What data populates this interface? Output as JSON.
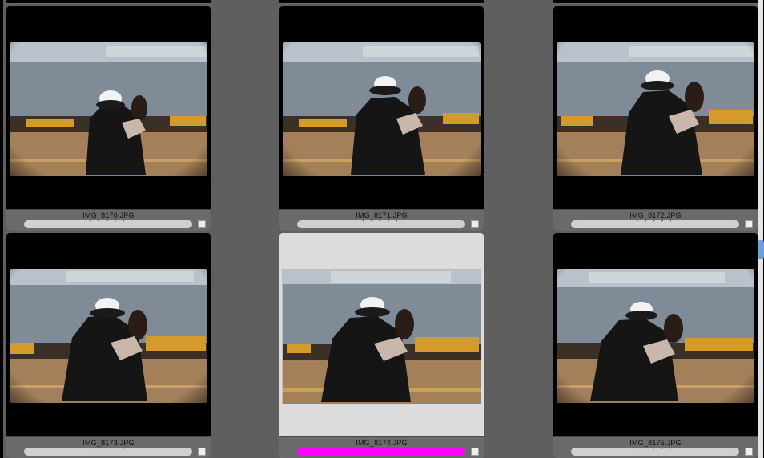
{
  "app": {
    "view": "grid"
  },
  "colors": {
    "background": "#5f5f5f",
    "cell": "#000000",
    "selected_cell": "#dcdcdc",
    "label_default": "#d0d0d0",
    "label_selected": "#ff00ff"
  },
  "thumbnails": [
    {
      "filename": "IMG_8170.JPG",
      "selected": false,
      "label": "none",
      "rating_dots": "• • • • •"
    },
    {
      "filename": "IMG_8171.JPG",
      "selected": false,
      "label": "none",
      "rating_dots": "• • • • •"
    },
    {
      "filename": "IMG_8172.JPG",
      "selected": false,
      "label": "none",
      "rating_dots": "• • • • •"
    },
    {
      "filename": "IMG_8173.JPG",
      "selected": false,
      "label": "none",
      "rating_dots": "• • • • •"
    },
    {
      "filename": "IMG_8174.JPG",
      "selected": true,
      "label": "magenta",
      "rating_dots": "• • • • •"
    },
    {
      "filename": "IMG_8175.JPG",
      "selected": false,
      "label": "none",
      "rating_dots": "• • • • •"
    }
  ],
  "icons": {
    "check": "checkbox-icon",
    "scroll": "scrollbar-thumb"
  }
}
